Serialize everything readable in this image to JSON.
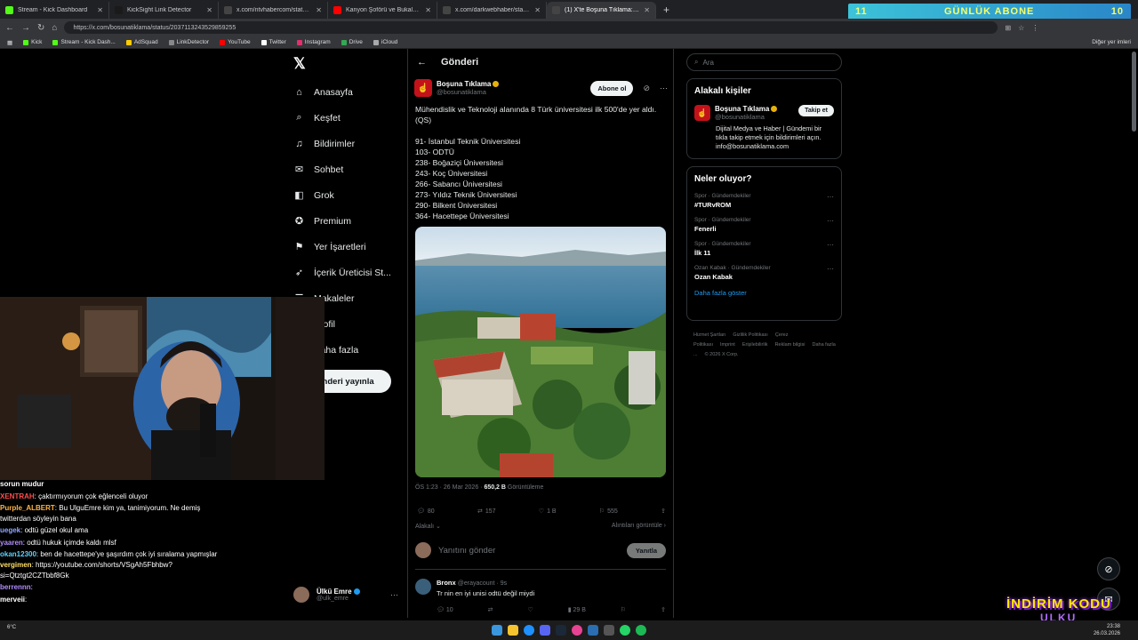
{
  "browser": {
    "tabs": [
      {
        "title": "Stream - Kick Dashboard",
        "color": "#53fc18",
        "active": false
      },
      {
        "title": "KickSight Link Detector",
        "color": "#1a1a1a",
        "active": false
      },
      {
        "title": "x.com/ntvhabercom/status/203616",
        "color": "#444",
        "active": false
      },
      {
        "title": "Kanyon Şoförü ve Bukalemun - Yo",
        "color": "#ff0000",
        "active": false
      },
      {
        "title": "x.com/darkwebhaber/status/2037",
        "color": "#444",
        "active": false
      },
      {
        "title": "(1) X'te Boşuna Tıklama: \"Mühendi",
        "color": "#444",
        "active": true
      }
    ],
    "url": "https://x.com/bosunatiklama/status/2037113243529859255",
    "bookmarks": [
      {
        "label": "Kick",
        "color": "#53fc18"
      },
      {
        "label": "Stream - Kick Dash...",
        "color": "#53fc18"
      },
      {
        "label": "AdSquad",
        "color": "#ffcc00"
      },
      {
        "label": "LinkDetector",
        "color": "#888"
      },
      {
        "label": "YouTube",
        "color": "#ff0000"
      },
      {
        "label": "Twitter",
        "color": "#fff"
      },
      {
        "label": "Instagram",
        "color": "#e1306c"
      },
      {
        "label": "Drive",
        "color": "#34a853"
      },
      {
        "label": "iCloud",
        "color": "#aaa"
      }
    ],
    "bookmarks_right": "Diğer yer imleri",
    "sub_banner": {
      "left": "11",
      "center": "GÜNLÜK ABONE",
      "right": "10"
    }
  },
  "nav": {
    "items": [
      {
        "label": "Anasayfa",
        "icon": "⌂"
      },
      {
        "label": "Keşfet",
        "icon": "⌕"
      },
      {
        "label": "Bildirimler",
        "icon": "♫"
      },
      {
        "label": "Sohbet",
        "icon": "✉"
      },
      {
        "label": "Grok",
        "icon": "◧"
      },
      {
        "label": "Premium",
        "icon": "✪"
      },
      {
        "label": "Yer İşaretleri",
        "icon": "⚑"
      },
      {
        "label": "İçerik Üreticisi St...",
        "icon": "➶"
      },
      {
        "label": "Makaleler",
        "icon": "☰"
      },
      {
        "label": "Profil",
        "icon": "☺"
      },
      {
        "label": "Daha fazla",
        "icon": "⋯"
      }
    ],
    "post_button": "Gönderi yayınla",
    "profile": {
      "name": "Ülkü Emre",
      "handle": "@ulk_emre"
    }
  },
  "main": {
    "header": "Gönderi",
    "author": {
      "name": "Boşuna Tıklama",
      "handle": "@bosunatiklama",
      "subscribe": "Abone ol"
    },
    "tweet_lines": [
      "Mühendislik ve Teknoloji alanında 8 Türk üniversitesi ilk 500'de yer aldı. (QS)",
      "",
      "91- İstanbul Teknik Üniversitesi",
      "103- ODTÜ",
      "238- Boğaziçi Üniversitesi",
      "243- Koç Üniversitesi",
      "266- Sabancı Üniversitesi",
      "273- Yıldız Teknik Üniversitesi",
      "290- Bilkent Üniversitesi",
      "364- Hacettepe Üniversitesi"
    ],
    "meta": {
      "time": "ÖS 1:23 · 26 Mar 2026 · ",
      "views": "650,2 B",
      "views_label": " Görüntüleme"
    },
    "actions": {
      "replies": "80",
      "reposts": "157",
      "likes": "1 B",
      "bookmarks": "555"
    },
    "sort_left": "Alakalı",
    "sort_right": "Alıntıları görüntüle",
    "reply_placeholder": "Yanıtını gönder",
    "reply_button": "Yanıtla",
    "reply": {
      "name": "Bronx",
      "handle": "@erayacount · 9s",
      "text": "Tr nin en iyi unisi odtü değil miydi",
      "replies": "10",
      "likes": "",
      "views": "29 B"
    }
  },
  "right": {
    "search_placeholder": "Ara",
    "related_title": "Alakalı kişiler",
    "related": {
      "name": "Boşuna Tıklama",
      "handle": "@bosunatiklama",
      "follow": "Takip et",
      "bio": "Dijital Medya ve Haber | Gündemi bir tıkla takip etmek için bildirimleri açın. info@bosunatiklama.com"
    },
    "trends_title": "Neler oluyor?",
    "trends": [
      {
        "cat": "Spor · Gündemdekiler",
        "name": "#TURvROM"
      },
      {
        "cat": "Spor · Gündemdekiler",
        "name": "Fenerli"
      },
      {
        "cat": "Spor · Gündemdekiler",
        "name": "İlk 11"
      },
      {
        "cat": "Ozan Kabak · Gündemdekiler",
        "name": "Ozan Kabak"
      }
    ],
    "show_more": "Daha fazla göster",
    "footer": [
      "Hizmet Şartları",
      "Gizlilik Politikası",
      "Çerez Politikası",
      "Imprint",
      "Erişilebilirlik",
      "Reklam bilgisi",
      "Daha fazla ...",
      "© 2026 X Corp."
    ]
  },
  "chat": [
    {
      "user": "",
      "color": "#fff",
      "text": "sorun mudur"
    },
    {
      "user": "XENTRAH",
      "color": "#ff4d4d",
      "text": ": çaktırmıyorum çok eğlenceli oluyor"
    },
    {
      "user": "Purple_ALBERT",
      "color": "#ffb347",
      "text": ": Bu UlguEmre kim ya, tanimiyorum. Ne demiş twitterdan söyleyin bana"
    },
    {
      "user": "uegek",
      "color": "#8fa8ff",
      "text": ": odtü güzel okul ama"
    },
    {
      "user": "yaaren",
      "color": "#b28cff",
      "text": ": odtü hukuk içimde kaldı mlsf"
    },
    {
      "user": "okan12300",
      "color": "#5fd3ff",
      "text": ": ben de hacettepe'ye şaşırdım çok iyi sıralama yapmışlar"
    },
    {
      "user": "vergimen",
      "color": "#ffe066",
      "text": ": https://youtube.com/shorts/VSgAh5Fbhbw?si=Qtztgt2CZTbbf8Gk"
    },
    {
      "user": "berrennn",
      "color": "#b28cff",
      "text": ":"
    },
    {
      "user": "merveii",
      "color": "#fff",
      "text": ":"
    }
  ],
  "overlay": {
    "promo_line1": "İNDİRİM KODU",
    "promo_line2": "ULKU"
  },
  "taskbar": {
    "weather": "6°C",
    "time": "23:38",
    "date": "26.03.2026"
  }
}
